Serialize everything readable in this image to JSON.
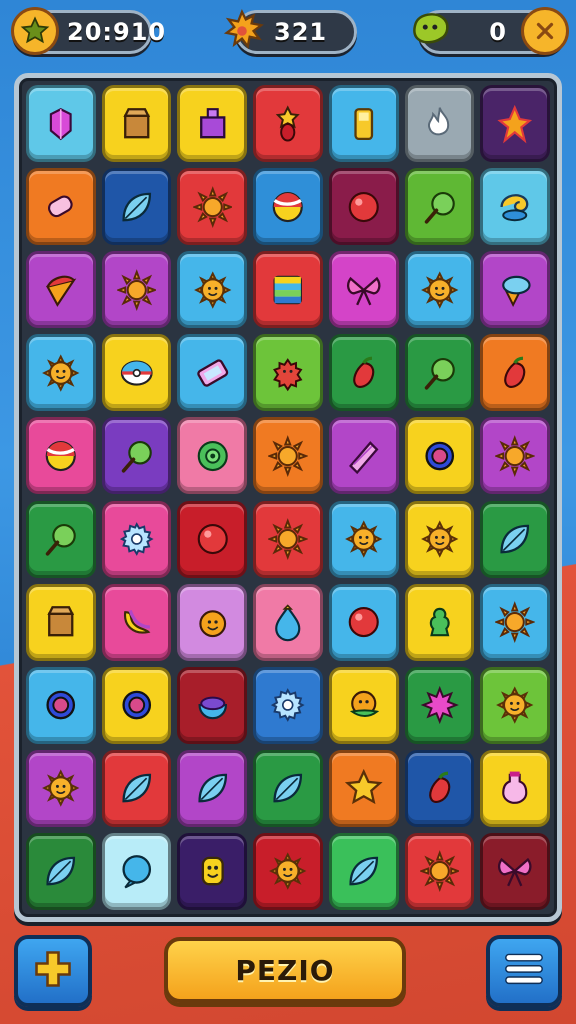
{
  "hud": {
    "score_value": "20:910",
    "score_icon": "star-coin-icon",
    "moves_value": "321",
    "moves_icon": "orange-splat-icon",
    "gems_value": "0",
    "gems_icon": "green-blob-icon",
    "gems_extra_icon": "cancel-coin-icon"
  },
  "board": {
    "columns": 7,
    "rows": 10,
    "tiles": [
      [
        {
          "color": "#5fc8e8",
          "icon": "gem"
        },
        {
          "color": "#f7d21e",
          "icon": "box"
        },
        {
          "color": "#f7d21e",
          "icon": "gift"
        },
        {
          "color": "#e2393b",
          "icon": "star-drop"
        },
        {
          "color": "#45b6ea",
          "icon": "gold-bar"
        },
        {
          "color": "#9aa9b2",
          "icon": "flame"
        },
        {
          "color": "#4a2468",
          "icon": "spark"
        }
      ],
      [
        {
          "color": "#f07a22",
          "icon": "candy"
        },
        {
          "color": "#1f56a8",
          "icon": "leaf"
        },
        {
          "color": "#e2393b",
          "icon": "sun"
        },
        {
          "color": "#2f8fd8",
          "icon": "ball"
        },
        {
          "color": "#8a1c4a",
          "icon": "orb"
        },
        {
          "color": "#5fb834",
          "icon": "lollipop"
        },
        {
          "color": "#5fc8e8",
          "icon": "swirl"
        }
      ],
      [
        {
          "color": "#b246c8",
          "icon": "cone"
        },
        {
          "color": "#b246c8",
          "icon": "sun"
        },
        {
          "color": "#45b6ea",
          "icon": "sun-face"
        },
        {
          "color": "#e2393b",
          "icon": "stripes"
        },
        {
          "color": "#d444c8",
          "icon": "bow"
        },
        {
          "color": "#45b6ea",
          "icon": "sun-face"
        },
        {
          "color": "#b246c8",
          "icon": "icecream"
        }
      ],
      [
        {
          "color": "#45b6ea",
          "icon": "sun-face"
        },
        {
          "color": "#f7d21e",
          "icon": "pokeball"
        },
        {
          "color": "#45b6ea",
          "icon": "bar"
        },
        {
          "color": "#6dc43a",
          "icon": "blob"
        },
        {
          "color": "#2a9a44",
          "icon": "pepper"
        },
        {
          "color": "#2a9a44",
          "icon": "lollipop"
        },
        {
          "color": "#f07a22",
          "icon": "pepper"
        }
      ],
      [
        {
          "color": "#e84a9a",
          "icon": "ball"
        },
        {
          "color": "#7a3cc0",
          "icon": "lollipop"
        },
        {
          "color": "#f07aa6",
          "icon": "donut"
        },
        {
          "color": "#f07a22",
          "icon": "sun"
        },
        {
          "color": "#b246c8",
          "icon": "crystal"
        },
        {
          "color": "#f7d21e",
          "icon": "ring"
        },
        {
          "color": "#b246c8",
          "icon": "sun"
        }
      ],
      [
        {
          "color": "#2a9a44",
          "icon": "lollipop"
        },
        {
          "color": "#e84a9a",
          "icon": "gear"
        },
        {
          "color": "#c81e2a",
          "icon": "orb"
        },
        {
          "color": "#e2393b",
          "icon": "sun"
        },
        {
          "color": "#45b6ea",
          "icon": "sun-face"
        },
        {
          "color": "#f7d21e",
          "icon": "sun-face"
        },
        {
          "color": "#2a9a44",
          "icon": "leaf"
        }
      ],
      [
        {
          "color": "#f7d21e",
          "icon": "box"
        },
        {
          "color": "#e84a9a",
          "icon": "banana"
        },
        {
          "color": "#d28ae0",
          "icon": "smile-drop"
        },
        {
          "color": "#f07aa6",
          "icon": "drop"
        },
        {
          "color": "#45b6ea",
          "icon": "orb"
        },
        {
          "color": "#f7d21e",
          "icon": "pawn"
        },
        {
          "color": "#45b6ea",
          "icon": "sun"
        }
      ],
      [
        {
          "color": "#45b6ea",
          "icon": "ring"
        },
        {
          "color": "#f7d21e",
          "icon": "ring"
        },
        {
          "color": "#a81e2a",
          "icon": "bowl"
        },
        {
          "color": "#2f7ad0",
          "icon": "gear"
        },
        {
          "color": "#f7d21e",
          "icon": "smile-leaf"
        },
        {
          "color": "#2a9a44",
          "icon": "spike"
        },
        {
          "color": "#6dc43a",
          "icon": "sun-face"
        }
      ],
      [
        {
          "color": "#b246c8",
          "icon": "sun-face"
        },
        {
          "color": "#e2393b",
          "icon": "leaf"
        },
        {
          "color": "#b246c8",
          "icon": "leaf"
        },
        {
          "color": "#2a9a44",
          "icon": "leaf"
        },
        {
          "color": "#f07a22",
          "icon": "star"
        },
        {
          "color": "#1f56a8",
          "icon": "pepper"
        },
        {
          "color": "#f7d21e",
          "icon": "bottle"
        }
      ],
      [
        {
          "color": "#2a8a3a",
          "icon": "leaf"
        },
        {
          "color": "#b8ecf8",
          "icon": "bubble"
        },
        {
          "color": "#3a1e68",
          "icon": "smile-block"
        },
        {
          "color": "#c81e2a",
          "icon": "sun-face"
        },
        {
          "color": "#3ac05a",
          "icon": "leaf"
        },
        {
          "color": "#e2393b",
          "icon": "sun"
        },
        {
          "color": "#8a1c2a",
          "icon": "bow"
        }
      ]
    ]
  },
  "buttons": {
    "add_icon": "plus-icon",
    "play_label": "PEZIO",
    "menu_icon": "hamburger-menu-icon"
  }
}
